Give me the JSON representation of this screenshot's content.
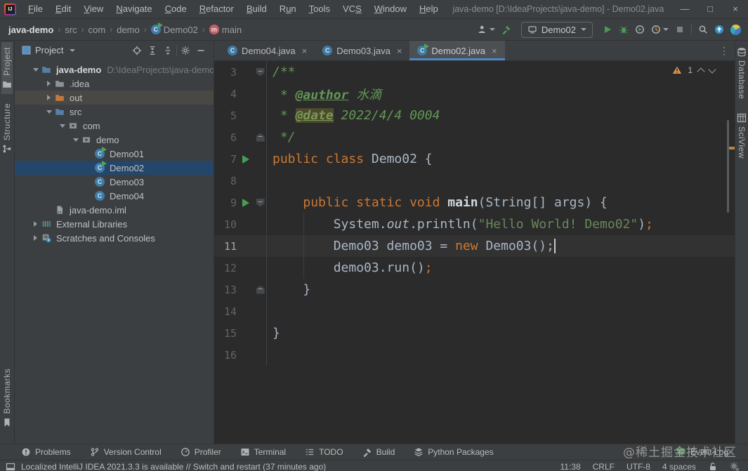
{
  "colors": {
    "accent_blue": "#4A88C7",
    "selection_blue": "#25466B",
    "keyword_orange": "#CC7832",
    "string_green": "#6A8759",
    "doc_green": "#629755",
    "run_green": "#499C54",
    "warning_orange": "#D6914A",
    "editor_bg": "#2B2B2B",
    "panel_bg": "#3C3F41",
    "current_line_bg": "#323232"
  },
  "icons": {
    "logo_text": "IJ",
    "class_letter": "C",
    "method_letter": "m",
    "breadcrumb_separator": "›",
    "fold_minus": "−",
    "tab_close": "×",
    "more_glyph": "⋮"
  },
  "title_bar": {
    "title": "java-demo [D:\\IdeaProjects\\java-demo] - Demo02.java",
    "menu": [
      {
        "label": "File",
        "m": 0
      },
      {
        "label": "Edit",
        "m": 0
      },
      {
        "label": "View",
        "m": 0
      },
      {
        "label": "Navigate",
        "m": 0
      },
      {
        "label": "Code",
        "m": 0
      },
      {
        "label": "Refactor",
        "m": 0
      },
      {
        "label": "Build",
        "m": 0
      },
      {
        "label": "Run",
        "m": 1
      },
      {
        "label": "Tools",
        "m": 0
      },
      {
        "label": "VCS",
        "m": 2
      },
      {
        "label": "Window",
        "m": 0
      },
      {
        "label": "Help",
        "m": 0
      }
    ],
    "controls": [
      {
        "name": "minimize-button",
        "glyph": "—"
      },
      {
        "name": "maximize-button",
        "glyph": "□"
      },
      {
        "name": "close-button",
        "glyph": "×"
      }
    ]
  },
  "nav_bar": {
    "breadcrumbs": [
      {
        "label": "java-demo",
        "bold": true
      },
      {
        "label": "src"
      },
      {
        "label": "com"
      },
      {
        "label": "demo"
      },
      {
        "label": "Demo02",
        "icon": "class-run"
      },
      {
        "label": "main",
        "icon": "method"
      }
    ],
    "run_config": "Demo02"
  },
  "left_stripe": {
    "top": [
      {
        "label": "Project",
        "icon": "project-stripe",
        "active": true
      },
      {
        "label": "Structure",
        "icon": "structure-stripe",
        "active": false
      }
    ],
    "bottom": [
      {
        "label": "Bookmarks",
        "icon": "bookmarks-stripe",
        "active": false
      }
    ]
  },
  "right_stripe": [
    {
      "label": "Database",
      "icon": "database-stripe"
    },
    {
      "label": "SciView",
      "icon": "sciview-stripe"
    }
  ],
  "project_panel": {
    "title": "Project",
    "header_buttons": [
      "locate",
      "expand-all",
      "collapse-all",
      "gear",
      "minus"
    ],
    "tree": [
      {
        "label": "java-demo",
        "sub": "D:\\IdeaProjects\\java-demo",
        "icon": "folder-root",
        "indent": 1,
        "chevron": "open",
        "bold": true
      },
      {
        "label": ".idea",
        "icon": "folder-gray",
        "indent": 2,
        "chevron": "closed"
      },
      {
        "label": "out",
        "icon": "folder-out",
        "indent": 2,
        "chevron": "closed",
        "hover": true
      },
      {
        "label": "src",
        "icon": "folder-src",
        "indent": 2,
        "chevron": "open"
      },
      {
        "label": "com",
        "icon": "package",
        "indent": 3,
        "chevron": "open"
      },
      {
        "label": "demo",
        "icon": "package",
        "indent": 4,
        "chevron": "open"
      },
      {
        "label": "Demo01",
        "icon": "class-run",
        "indent": 5
      },
      {
        "label": "Demo02",
        "icon": "class-run",
        "indent": 5,
        "selected": true
      },
      {
        "label": "Demo03",
        "icon": "class",
        "indent": 5
      },
      {
        "label": "Demo04",
        "icon": "class",
        "indent": 5
      },
      {
        "label": "java-demo.iml",
        "icon": "iml",
        "indent": 2
      },
      {
        "label": "External Libraries",
        "icon": "extlib",
        "indent": 1,
        "chevron": "closed"
      },
      {
        "label": "Scratches and Consoles",
        "icon": "scratch",
        "indent": 1,
        "chevron": "closed"
      }
    ]
  },
  "editor_tabs": [
    {
      "label": "Demo04.java",
      "icon": "class",
      "active": false
    },
    {
      "label": "Demo03.java",
      "icon": "class",
      "active": false
    },
    {
      "label": "Demo02.java",
      "icon": "class-run",
      "active": true
    }
  ],
  "editor": {
    "inspection_count": "1",
    "lines": [
      {
        "num": "3",
        "fold": "open",
        "seg": [
          [
            "d",
            "/**"
          ]
        ]
      },
      {
        "num": "4",
        "seg": [
          [
            "d",
            " * "
          ],
          [
            "dt",
            "@author"
          ],
          [
            "d",
            " 水滴"
          ]
        ]
      },
      {
        "num": "5",
        "seg": [
          [
            "d",
            " * "
          ],
          [
            "dth",
            "@date"
          ],
          [
            "d",
            " 2022/4/4 0004"
          ]
        ]
      },
      {
        "num": "6",
        "fold": "end",
        "seg": [
          [
            "d",
            " */"
          ]
        ]
      },
      {
        "num": "7",
        "run": true,
        "seg": [
          [
            "k",
            "public class "
          ],
          [
            "p",
            "Demo02 {"
          ]
        ]
      },
      {
        "num": "8",
        "seg": []
      },
      {
        "num": "9",
        "run": true,
        "fold": "open",
        "seg": [
          [
            "p",
            "    "
          ],
          [
            "k",
            "public static void "
          ],
          [
            "m",
            "main"
          ],
          [
            "p",
            "(String[] args) {"
          ]
        ]
      },
      {
        "num": "10",
        "seg": [
          [
            "p",
            "        System."
          ],
          [
            "f",
            "out"
          ],
          [
            "p",
            ".println("
          ],
          [
            "s",
            "\"Hello World! Demo02\""
          ],
          [
            "p",
            ")"
          ],
          [
            "o",
            ";"
          ]
        ]
      },
      {
        "num": "11",
        "current": true,
        "caret": true,
        "seg": [
          [
            "p",
            "        Demo03 demo03 = "
          ],
          [
            "k",
            "new "
          ],
          [
            "p",
            "Demo03();"
          ]
        ]
      },
      {
        "num": "12",
        "seg": [
          [
            "p",
            "        demo03.run()"
          ],
          [
            "o",
            ";"
          ]
        ]
      },
      {
        "num": "13",
        "fold": "end",
        "seg": [
          [
            "p",
            "    }"
          ]
        ]
      },
      {
        "num": "14",
        "seg": []
      },
      {
        "num": "15",
        "seg": [
          [
            "p",
            "}"
          ]
        ]
      },
      {
        "num": "16",
        "seg": []
      }
    ]
  },
  "bottom_bar": {
    "items": [
      {
        "label": "Problems",
        "icon": "problems"
      },
      {
        "label": "Version Control",
        "icon": "vcs"
      },
      {
        "label": "Profiler",
        "icon": "profiler-tab"
      },
      {
        "label": "Terminal",
        "icon": "terminal"
      },
      {
        "label": "TODO",
        "icon": "todo"
      },
      {
        "label": "Build",
        "icon": "build"
      },
      {
        "label": "Python Packages",
        "icon": "python"
      }
    ],
    "event_log": "Event Log"
  },
  "watermark": "@稀土掘金技术社区",
  "status_bar": {
    "message": "Localized IntelliJ IDEA 2021.3.3 is available // Switch and restart (37 minutes ago)",
    "time": "11:38",
    "line_ending": "CRLF",
    "encoding": "UTF-8",
    "indent": "4 spaces"
  }
}
